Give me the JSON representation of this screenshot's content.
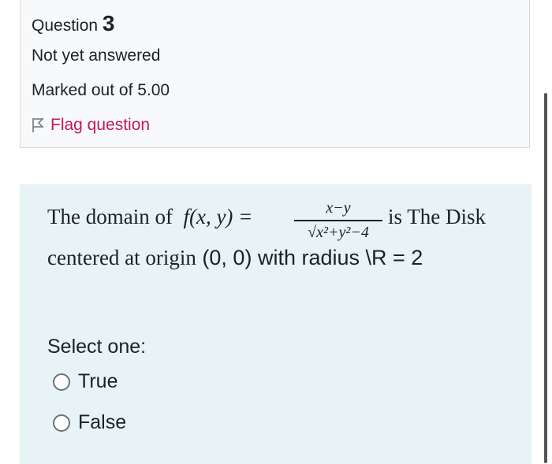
{
  "info": {
    "question_label": "Question",
    "question_number": "3",
    "state": "Not yet answered",
    "grade": "Marked out of 5.00",
    "flag_label": "Flag question"
  },
  "question": {
    "text_before": "The domain of",
    "func": "f(x, y) =",
    "numerator": "x−y",
    "denominator": "√x²+y²−4",
    "text_after": "is The Disk",
    "line2_serif": "centered at origin",
    "line2_sans": " (0, 0) with radius \\R = 2"
  },
  "answer": {
    "prompt": "Select one:",
    "options": [
      "True",
      "False"
    ]
  },
  "colors": {
    "flag": "#c2185b",
    "formulation_bg": "#e7f3f5",
    "info_bg": "#f8f9fa"
  }
}
